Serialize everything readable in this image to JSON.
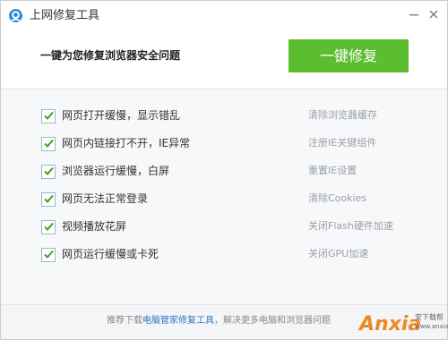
{
  "window": {
    "title": "上网修复工具",
    "minimize_icon": "minimize-icon",
    "close_icon": "close-icon"
  },
  "header": {
    "description": "一键为您修复浏览器安全问题",
    "fix_button_label": "一键修复"
  },
  "items": [
    {
      "label": "网页打开缓慢，显示错乱",
      "action": "清除浏览器缓存",
      "checked": true
    },
    {
      "label": "网页内链接打不开，IE异常",
      "action": "注册IE关键组件",
      "checked": true
    },
    {
      "label": "浏览器运行缓慢，白屏",
      "action": "重置IE设置",
      "checked": true
    },
    {
      "label": "网页无法正常登录",
      "action": "清除Cookies",
      "checked": true
    },
    {
      "label": "视频播放花屏",
      "action": "关闭Flash硬件加速",
      "checked": true
    },
    {
      "label": "网页运行缓慢或卡死",
      "action": "关闭GPU加速",
      "checked": true
    }
  ],
  "footer": {
    "prefix": "推荐下载",
    "link": "电脑管家修复工具",
    "suffix": "，解决更多电脑和浏览器问题"
  },
  "watermark": {
    "brand": "Anxia",
    "domain_suffix": ".com",
    "sub_cn": "安下载帮",
    "sub_url": "www.anxia.com"
  },
  "colors": {
    "accent_green": "#5cbd2f",
    "link_blue": "#2f76c6",
    "check_green": "#3fa22a",
    "watermark_orange": "#e98a25"
  }
}
